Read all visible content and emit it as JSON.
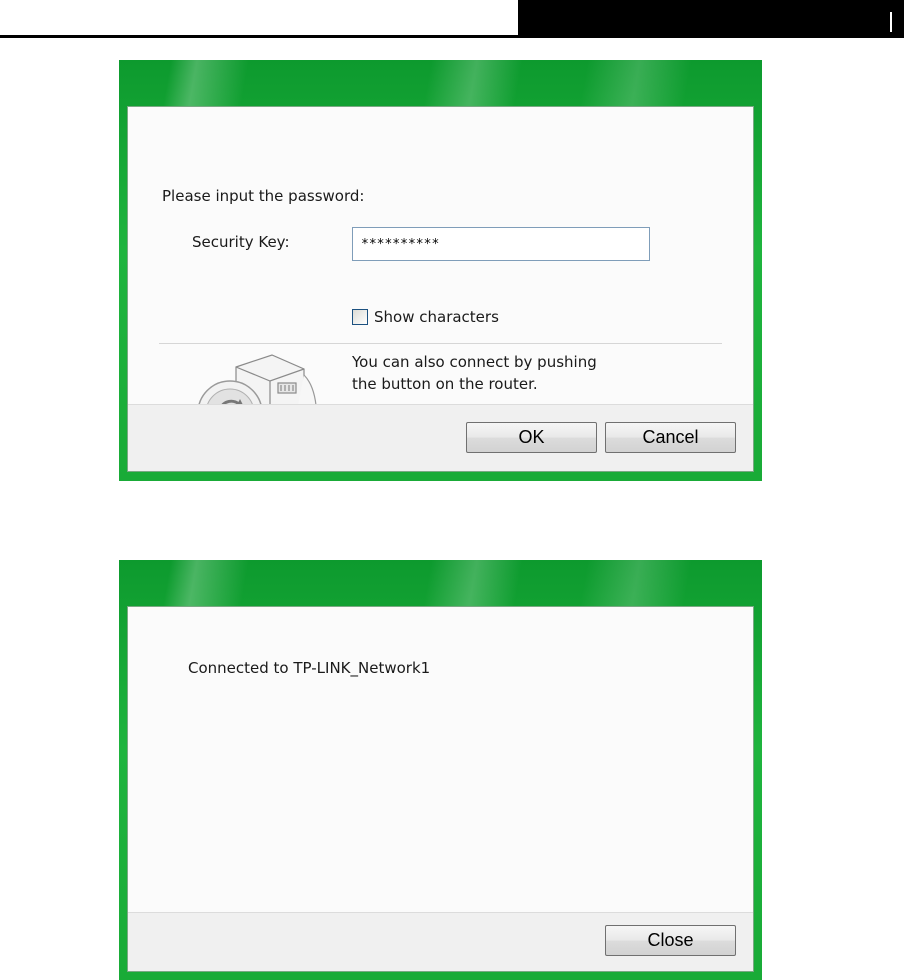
{
  "password_dialog": {
    "prompt": "Please input the password:",
    "security_key_label": "Security Key:",
    "security_key_value": "**********",
    "show_characters_label": "Show characters",
    "show_characters_checked": false,
    "push_button_line1": "You can also connect by pushing",
    "push_button_line2": "the button on the router.",
    "ok_label": "OK",
    "cancel_label": "Cancel",
    "icon": "router-push-button-icon"
  },
  "connected_dialog": {
    "message": "Connected to TP-LINK_Network1",
    "close_label": "Close"
  },
  "colors": {
    "frame_green": "#1fb43e",
    "client_bg": "#fbfbfb",
    "footer_bg": "#f0f0f0"
  }
}
